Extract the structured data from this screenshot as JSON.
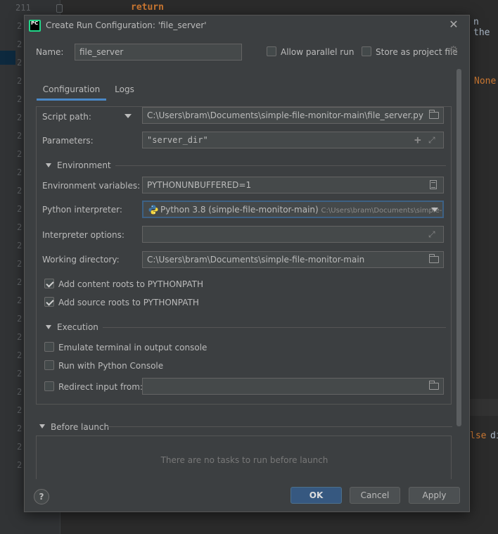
{
  "editor": {
    "line_number": "211",
    "gutter_digit": "2",
    "code_return": "return",
    "code_then": "n the",
    "code_none": "None",
    "code_else": "lse",
    "code_di": "di"
  },
  "dialog": {
    "app_icon_text": "PC",
    "title": "Create Run Configuration: 'file_server'",
    "name_label": "Name:",
    "name_value": "file_server",
    "allow_parallel_label": "Allow parallel run",
    "allow_parallel_checked": false,
    "store_project_label": "Store as project file",
    "store_project_checked": false,
    "tabs": [
      {
        "label": "Configuration",
        "active": true
      },
      {
        "label": "Logs",
        "active": false
      }
    ],
    "script_path_label": "Script path:",
    "script_path_value": "C:\\Users\\bram\\Documents\\simple-file-monitor-main\\file_server.py",
    "parameters_label": "Parameters:",
    "parameters_value": "\"server_dir\"",
    "environment_section": "Environment",
    "env_vars_label": "Environment variables:",
    "env_vars_value": "PYTHONUNBUFFERED=1",
    "python_interpreter_label": "Python interpreter:",
    "python_interpreter_value": "Python 3.8 (simple-file-monitor-main)",
    "python_interpreter_path": "C:\\Users\\bram\\Documents\\simple-",
    "interpreter_options_label": "Interpreter options:",
    "interpreter_options_value": "",
    "working_dir_label": "Working directory:",
    "working_dir_value": "C:\\Users\\bram\\Documents\\simple-file-monitor-main",
    "add_content_roots_label": "Add content roots to PYTHONPATH",
    "add_content_roots_checked": true,
    "add_source_roots_label": "Add source roots to PYTHONPATH",
    "add_source_roots_checked": true,
    "execution_section": "Execution",
    "emulate_terminal_label": "Emulate terminal in output console",
    "emulate_terminal_checked": false,
    "python_console_label": "Run with Python Console",
    "python_console_checked": false,
    "redirect_input_label": "Redirect input from:",
    "redirect_input_checked": false,
    "redirect_input_value": "",
    "before_launch_label": "Before launch",
    "before_launch_empty": "There are no tasks to run before launch",
    "help_label": "?",
    "ok_label": "OK",
    "cancel_label": "Cancel",
    "apply_label": "Apply"
  },
  "colors": {
    "accent": "#4a88c7",
    "ok_button": "#365880",
    "dialog_bg": "#3c3f41",
    "editor_bg": "#2b2b2b",
    "keyword": "#cc7832"
  },
  "icons": [
    "pycharm-app-icon",
    "close-icon",
    "gear-icon",
    "dropdown-arrow-icon",
    "folder-icon",
    "plus-icon",
    "expand-icon",
    "document-icon",
    "python-logo-icon",
    "help-icon"
  ]
}
